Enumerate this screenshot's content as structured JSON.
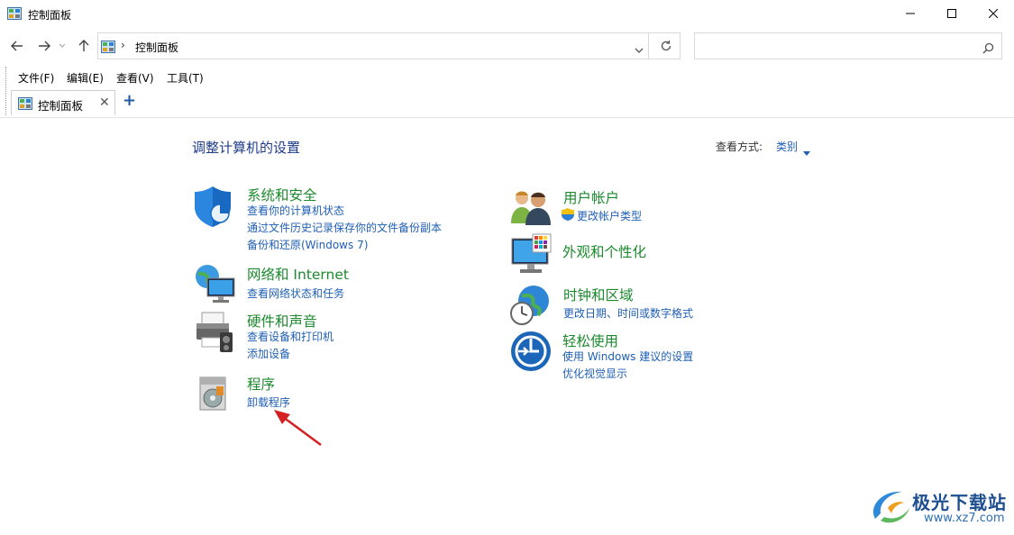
{
  "window": {
    "title": "控制面板"
  },
  "address": {
    "path": "控制面板"
  },
  "search": {
    "placeholder": ""
  },
  "menu": {
    "items": [
      "文件(F)",
      "编辑(E)",
      "查看(V)",
      "工具(T)"
    ]
  },
  "tabs": {
    "active_label": "控制面板",
    "new_tab": "+"
  },
  "main": {
    "heading": "调整计算机的设置",
    "view_by_label": "查看方式:",
    "view_by_value": "类别"
  },
  "categories": [
    {
      "title": "系统和安全",
      "links": [
        "查看你的计算机状态",
        "通过文件历史记录保存你的文件备份副本",
        "备份和还原(Windows 7)"
      ],
      "icon": "shield-icon"
    },
    {
      "title": "网络和 Internet",
      "links": [
        "查看网络状态和任务"
      ],
      "icon": "network-icon"
    },
    {
      "title": "硬件和声音",
      "links": [
        "查看设备和打印机",
        "添加设备"
      ],
      "icon": "printer-icon"
    },
    {
      "title": "程序",
      "links": [
        "卸载程序"
      ],
      "icon": "programs-icon"
    },
    {
      "title": "用户帐户",
      "links": [
        "更改帐户类型"
      ],
      "icon": "users-icon"
    },
    {
      "title": "外观和个性化",
      "links": [],
      "icon": "appearance-icon"
    },
    {
      "title": "时钟和区域",
      "links": [
        "更改日期、时间或数字格式"
      ],
      "icon": "clock-globe-icon"
    },
    {
      "title": "轻松使用",
      "links": [
        "使用 Windows 建议的设置",
        "优化视觉显示"
      ],
      "icon": "ease-of-access-icon"
    }
  ],
  "watermark": {
    "title": "极光下载站",
    "url": "www.xz7.com"
  },
  "colors": {
    "category_title": "#1c8a2e",
    "link": "#1f5fb5",
    "heading": "#1e3c8a",
    "annotation_arrow": "#d42020"
  }
}
